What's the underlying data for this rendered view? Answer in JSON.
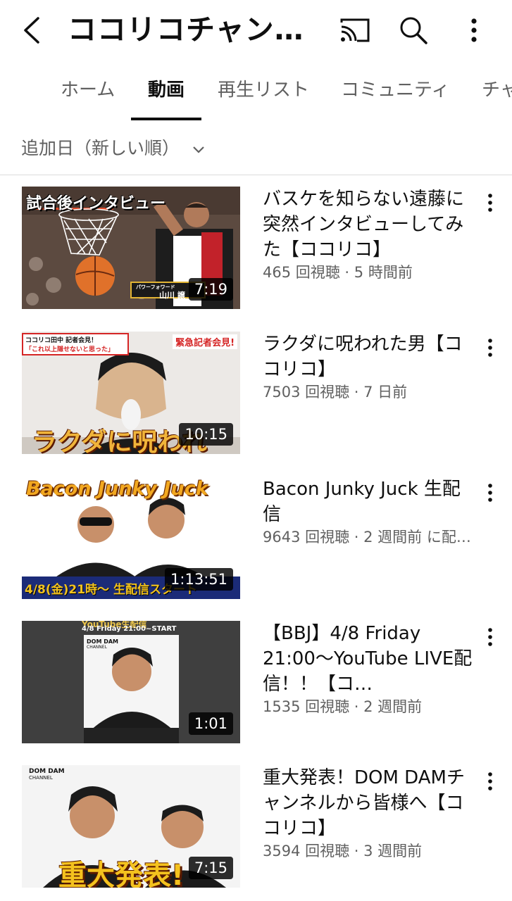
{
  "header": {
    "title": "ココリコチャン…",
    "icons": {
      "back": "back-arrow-icon",
      "cast": "cast-icon",
      "search": "search-icon",
      "more": "more-vertical-icon"
    }
  },
  "tabs": [
    {
      "label": "ホーム",
      "active": false
    },
    {
      "label": "動画",
      "active": true
    },
    {
      "label": "再生リスト",
      "active": false
    },
    {
      "label": "コミュニティ",
      "active": false
    },
    {
      "label": "チャ",
      "active": false
    }
  ],
  "sort": {
    "label": "追加日（新しい順）"
  },
  "videos": [
    {
      "title": "バスケを知らない遠藤に突然インタビューしてみた【ココリコ】",
      "meta": "465 回視聴 · 5 時間前",
      "duration": "7:19",
      "thumb": {
        "caption": "試合後インタビュー",
        "lower_label": "パワーフォワード",
        "name_label": "山川 譲"
      }
    },
    {
      "title": "ラクダに呪われた男【ココリコ】",
      "meta": "7503 回視聴 · 7 日前",
      "duration": "10:15",
      "thumb": {
        "top_left": "ココリコ田中 記者会見！",
        "top_left_sub": "「これ以上隠せないと思った」",
        "top_right": "緊急記者会見!",
        "bottom": "ラクダに呪われ"
      }
    },
    {
      "title": "Bacon Junky Juck 生配信",
      "meta": "9643 回視聴 · 2 週間前 に配…",
      "duration": "1:13:51",
      "thumb": {
        "top": "Bacon Junky Juck",
        "bottom": "4/8(金)21時〜 生配信スタート"
      }
    },
    {
      "title": "【BBJ】4/8 Friday 21:00〜YouTube LIVE配信！！【コ…",
      "meta": "1535 回視聴 · 2 週間前",
      "duration": "1:01",
      "thumb": {
        "top": "YouTube生配信",
        "top_sub": "4/8 Friday 21:00~START",
        "logo": "DOM DAM",
        "logo_sub": "CHANNEL"
      }
    },
    {
      "title": "重大発表！DOM DAMチャンネルから皆様へ【ココリコ】",
      "meta": "3594 回視聴 · 3 週間前",
      "duration": "7:15",
      "thumb": {
        "logo": "DOM DAM",
        "logo_sub": "CHANNEL",
        "bottom": "重大発表!"
      }
    }
  ]
}
